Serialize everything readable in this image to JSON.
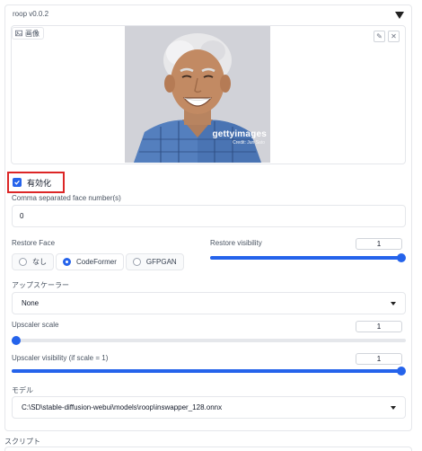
{
  "panel": {
    "title": "roop v0.0.2"
  },
  "image": {
    "label": "画像",
    "watermark": "gettyimages",
    "watermark_sub": "Credit: Jun Sato"
  },
  "enable": {
    "label": "有効化",
    "checked": true
  },
  "face_numbers": {
    "label": "Comma separated face number(s)",
    "value": "0"
  },
  "restore_face": {
    "label": "Restore Face",
    "options": [
      "なし",
      "CodeFormer",
      "GFPGAN"
    ],
    "selected": "CodeFormer"
  },
  "restore_visibility": {
    "label": "Restore visibility",
    "value": "1",
    "fraction": 1.0
  },
  "upscaler": {
    "label": "アップスケーラー",
    "value": "None"
  },
  "upscaler_scale": {
    "label": "Upscaler scale",
    "value": "1",
    "fraction": 0.0
  },
  "upscaler_visibility": {
    "label": "Upscaler visibility (if scale = 1)",
    "value": "1",
    "fraction": 1.0
  },
  "model": {
    "label": "モデル",
    "value": "C:\\SD\\stable-diffusion-webui\\models\\roop\\inswapper_128.onnx"
  },
  "script": {
    "label": "スクリプト"
  },
  "colors": {
    "accent": "#2563eb",
    "highlight_border": "#dc2626"
  }
}
